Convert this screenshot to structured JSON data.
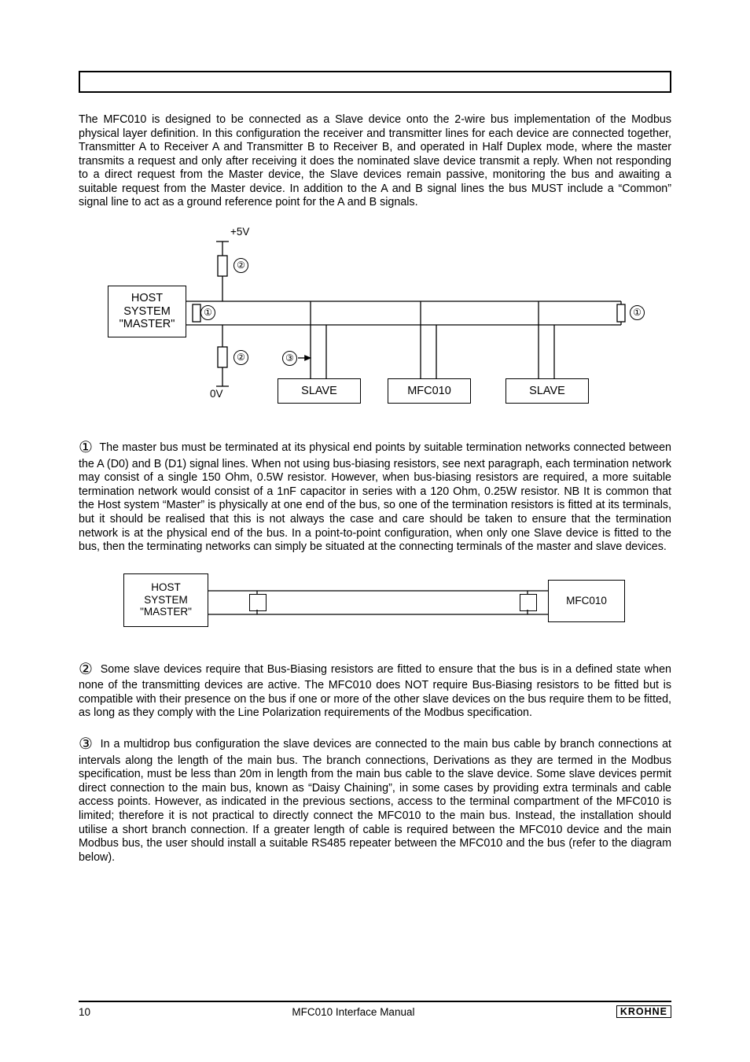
{
  "paragraphs": {
    "intro": "The MFC010 is designed to be connected as a Slave device onto the 2-wire bus implementation of the Modbus physical layer definition.  In this configuration the receiver and transmitter lines for each device are connected together, Transmitter A to Receiver A and Transmitter B to Receiver B, and operated in Half Duplex mode, where the master transmits a request and only after receiving it does the nominated slave device transmit a reply.  When not responding to a direct request from the Master device, the Slave devices remain passive, monitoring the bus and awaiting a suitable request from the Master device.  In addition to the A and B signal lines the bus MUST include a “Common” signal line to act as a ground reference point for the A and B signals.",
    "note1": "The master bus must be terminated at its physical end points by suitable termination networks connected between the A (D0) and B (D1) signal lines.  When not using bus-biasing resistors, see next paragraph, each termination network may consist of a single 150 Ohm, 0.5W resistor.  However, when bus-biasing resistors are required, a more suitable termination network would consist of a 1nF capacitor in series with a 120 Ohm, 0.25W resistor.  NB It is common that the Host system “Master” is physically at one end of the bus, so one of the termination resistors is fitted at its terminals, but it should be realised that this is not always the case and care should be taken to ensure that the termination network is at the physical end of the bus.  In a point-to-point configuration, when only one Slave device is fitted to the bus, then the terminating networks can simply be situated at the connecting terminals of the master and slave devices.",
    "note2": "Some slave devices require that Bus-Biasing resistors are fitted to ensure that the bus is in a defined state when none of the transmitting devices are active.  The MFC010 does NOT require Bus-Biasing resistors to be fitted but is compatible with their presence on the bus if one or more of the other slave devices on the bus require them to be fitted, as long as they comply with the Line Polarization requirements of the Modbus specification.",
    "note3": "In a multidrop bus configuration the slave devices are connected to the main bus cable by branch connections at intervals along the length of the main bus.  The branch connections, Derivations as they are termed in the Modbus specification, must be less than 20m in length from the main bus cable to the slave device.  Some slave devices permit direct connection to the main bus, known as “Daisy Chaining”, in some cases by providing extra terminals and cable access points.  However, as indicated in the previous sections, access to the terminal compartment of the MFC010 is limited; therefore it is not practical to directly connect the MFC010 to the main bus.  Instead, the installation should utilise a short branch connection.  If a greater length of cable is required between the MFC010 device and the main Modbus bus, the user should install a suitable RS485 repeater between the MFC010 and the bus (refer to the diagram below)."
  },
  "markers": {
    "one": "①",
    "two": "②",
    "three": "③"
  },
  "diagram1": {
    "plus5v": "+5V",
    "zerov": "0V",
    "host1": "HOST",
    "host2": "SYSTEM",
    "host3": "\"MASTER\"",
    "slave": "SLAVE",
    "mfc": "MFC010"
  },
  "diagram2": {
    "host1": "HOST",
    "host2": "SYSTEM",
    "host3": "\"MASTER\"",
    "mfc": "MFC010"
  },
  "footer": {
    "page": "10",
    "title": "MFC010 Interface Manual",
    "brand": "KROHNE"
  }
}
